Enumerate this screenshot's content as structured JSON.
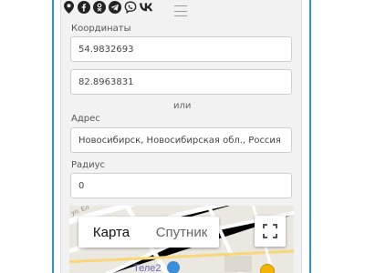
{
  "icons": [
    "map-pin-icon",
    "facebook-icon",
    "odnoklassniki-icon",
    "telegram-icon",
    "viber-icon",
    "vk-icon"
  ],
  "vk_label": "VK",
  "coordinates": {
    "label": "Координаты",
    "latitude": "54.9832693",
    "longitude": "82.8963831"
  },
  "or_text": "или",
  "address": {
    "label": "Адрес",
    "value": "Новосибирск, Новосибирская обл., Россия"
  },
  "radius": {
    "label": "Радиус",
    "value": "0"
  },
  "map": {
    "type_map": "Карта",
    "type_satellite": "Спутник",
    "place_label": "Теле2",
    "street_label": "ул. Ел"
  },
  "colors": {
    "accent": "#2f8fd8",
    "panel": "#f2f2f2"
  }
}
